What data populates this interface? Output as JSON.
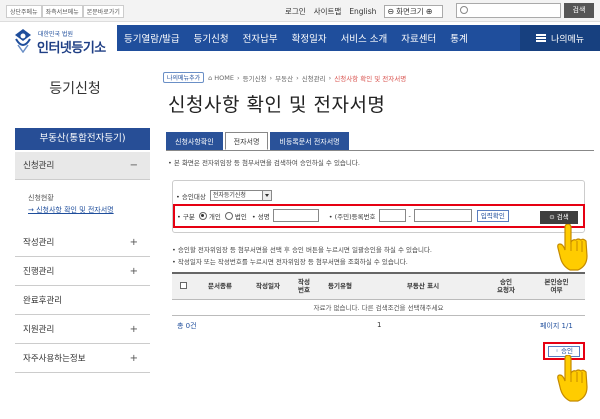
{
  "top": {
    "links": [
      "상단주메뉴",
      "좌측서브메뉴",
      "본문바로가기"
    ],
    "login": "로그인",
    "sitemap": "사이트맵",
    "english": "English",
    "screen_size": "화면크기",
    "search_btn": "검색"
  },
  "logo": {
    "small": "대한민국 법원",
    "big": "인터넷등기소"
  },
  "gnb": {
    "items": [
      "등기열람/발급",
      "등기신청",
      "전자납부",
      "확정일자",
      "서비스 소개",
      "자료센터",
      "통계"
    ],
    "mymenu": "나의메뉴"
  },
  "sidebar": {
    "title": "등기신청",
    "head": "부동산(통합전자등기)",
    "items": [
      {
        "label": "신청관리",
        "mark": "−"
      },
      {
        "label": "작성관리",
        "mark": "+"
      },
      {
        "label": "진행관리",
        "mark": "+"
      },
      {
        "label": "완료후관리",
        "mark": ""
      },
      {
        "label": "지원관리",
        "mark": "+"
      },
      {
        "label": "자주사용하는정보",
        "mark": "+"
      }
    ],
    "sub": [
      "신청현황",
      "→ 신청사항 확인 및 전자서명"
    ]
  },
  "breadcrumb": {
    "mymenu": "나의메뉴추가",
    "path": [
      "HOME",
      "등기신청",
      "부동산",
      "신청관리"
    ],
    "current": "신청사항 확인 및 전자서명"
  },
  "page_title": "신청사항 확인 및 전자서명",
  "tabs": [
    "신청사항확인",
    "전자서명",
    "비등록문서 전자서명"
  ],
  "notice1": "• 본 화면은 전자위임장 등 첨부서면을 검색하여 승인하실 수 있습니다.",
  "search": {
    "target_label": "• 승인대상",
    "target_value": "전자등기신청",
    "type_label": "• 구분",
    "personal": "개인",
    "corporate": "법인",
    "name_label": "• 성명",
    "id_label": "• (주민)등록번호",
    "dash": "-",
    "confirm_btn": "입력확인",
    "search_btn": "검색"
  },
  "notice2": [
    "• 승인할 전자위임장 등 첨부서면을 선택 후 승인 버튼을 누르시면 일괄승인을 하실 수 있습니다.",
    "• 작성일자 또는 작성번호를 누르시면 전자위임장 등 첨부서면을 조회하실 수 있습니다."
  ],
  "table": {
    "headers": [
      "문서종류",
      "작성일자",
      "작성\n번호",
      "등기유형",
      "부동산 표시",
      "승인\n요청자",
      "본인승인\n여부"
    ],
    "empty": "자료가 없습니다. 다른 검색조건을 선택해주세요"
  },
  "footer": {
    "total": "총 0건",
    "page": "1",
    "page_info": "페이지 1/1",
    "approve_btn": "승인"
  }
}
